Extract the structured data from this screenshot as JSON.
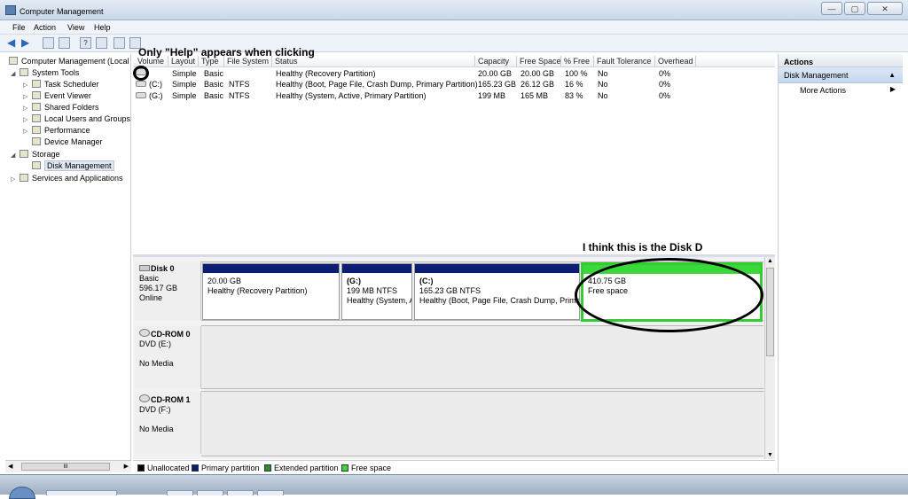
{
  "window": {
    "title": "Computer Management",
    "buttons": [
      "—",
      "▢",
      "✕"
    ]
  },
  "menu": [
    "File",
    "Action",
    "View",
    "Help"
  ],
  "tree": {
    "root": "Computer Management (Local",
    "system_tools": "System Tools",
    "task_scheduler": "Task Scheduler",
    "event_viewer": "Event Viewer",
    "shared_folders": "Shared Folders",
    "local_users": "Local Users and Groups",
    "performance": "Performance",
    "device_manager": "Device Manager",
    "storage": "Storage",
    "disk_management": "Disk Management",
    "services": "Services and Applications",
    "scroll_grip": "III"
  },
  "volume_table": {
    "columns": [
      "Volume",
      "Layout",
      "Type",
      "File System",
      "Status",
      "Capacity",
      "Free Space",
      "% Free",
      "Fault Tolerance",
      "Overhead"
    ],
    "rows": [
      {
        "volume": "",
        "layout": "Simple",
        "type": "Basic",
        "fs": "",
        "status": "Healthy (Recovery Partition)",
        "capacity": "20.00 GB",
        "free": "20.00 GB",
        "pct": "100 %",
        "fault": "No",
        "overhead": "0%"
      },
      {
        "volume": "(C:)",
        "layout": "Simple",
        "type": "Basic",
        "fs": "NTFS",
        "status": "Healthy (Boot, Page File, Crash Dump, Primary Partition)",
        "capacity": "165.23 GB",
        "free": "26.12 GB",
        "pct": "16 %",
        "fault": "No",
        "overhead": "0%"
      },
      {
        "volume": "(G:)",
        "layout": "Simple",
        "type": "Basic",
        "fs": "NTFS",
        "status": "Healthy (System, Active, Primary Partition)",
        "capacity": "199 MB",
        "free": "165 MB",
        "pct": "83 %",
        "fault": "No",
        "overhead": "0%"
      }
    ]
  },
  "disks": {
    "disk0": {
      "name": "Disk 0",
      "type": "Basic",
      "size": "596.17 GB",
      "status": "Online",
      "partitions": [
        {
          "title": "",
          "size": "20.00 GB",
          "status": "Healthy (Recovery Partition)"
        },
        {
          "title": "(G:)",
          "size": "199 MB NTFS",
          "status": "Healthy (System, A"
        },
        {
          "title": "(C:)",
          "size": "165.23 GB NTFS",
          "status": "Healthy (Boot, Page File, Crash Dump, Prima"
        },
        {
          "title": "",
          "size": "410.75 GB",
          "status": "Free space"
        }
      ]
    },
    "cdrom0": {
      "name": "CD-ROM 0",
      "drive": "DVD (E:)",
      "media": "No Media"
    },
    "cdrom1": {
      "name": "CD-ROM 1",
      "drive": "DVD (F:)",
      "media": "No Media"
    }
  },
  "legend": [
    {
      "label": "Unallocated",
      "color": "#000000"
    },
    {
      "label": "Primary partition",
      "color": "#0c1e73"
    },
    {
      "label": "Extended partition",
      "color": "#2e8b2e"
    },
    {
      "label": "Free space",
      "color": "#3ad83a"
    }
  ],
  "actions": {
    "header": "Actions",
    "section": "Disk Management",
    "more": "More Actions"
  },
  "annotations": {
    "help_note": "Only \"Help\" appears when clicking",
    "disk_d_note": "I think this is the Disk D"
  }
}
